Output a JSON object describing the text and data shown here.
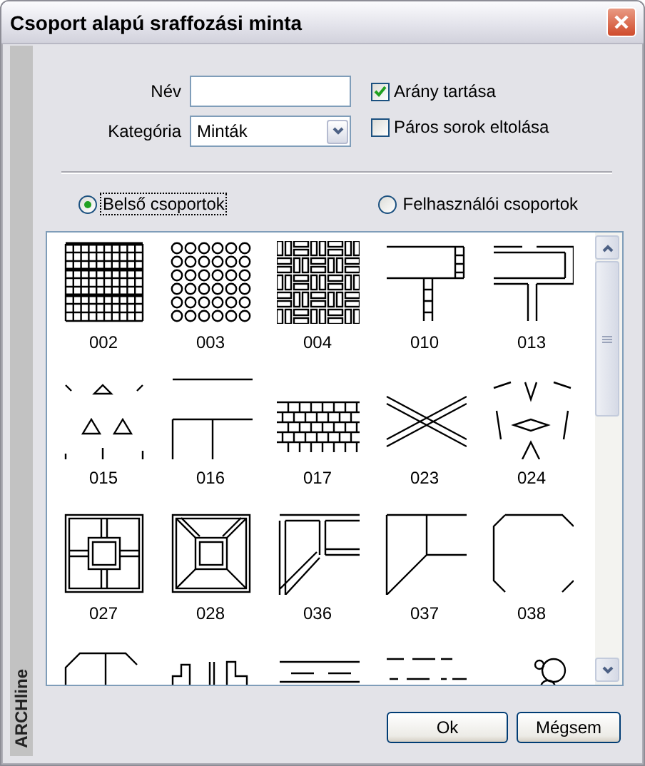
{
  "window": {
    "title": "Csoport alapú sraffozási minta"
  },
  "side_label": "ARCHline",
  "form": {
    "name": {
      "label": "Név"
    },
    "category": {
      "label": "Kategória",
      "value": "Minták"
    }
  },
  "options": [
    {
      "label": "Arány tartása",
      "checked": true
    },
    {
      "label": "Páros sorok eltolása",
      "checked": false
    }
  ],
  "groups": [
    {
      "label": "Belső csoportok",
      "selected": true
    },
    {
      "label": "Felhasználói csoportok",
      "selected": false
    }
  ],
  "patterns": [
    {
      "kind": "pattern",
      "label": "002"
    },
    {
      "kind": "pattern",
      "label": "003"
    },
    {
      "kind": "pattern",
      "label": "004"
    },
    {
      "kind": "pattern",
      "label": "010"
    },
    {
      "kind": "pattern",
      "label": "013"
    },
    {
      "kind": "pattern",
      "label": "015"
    },
    {
      "kind": "pattern",
      "label": "016"
    },
    {
      "kind": "pattern",
      "label": "017"
    },
    {
      "kind": "pattern",
      "label": "023"
    },
    {
      "kind": "pattern",
      "label": "024"
    },
    {
      "kind": "pattern",
      "label": "027"
    },
    {
      "kind": "pattern",
      "label": "028"
    },
    {
      "kind": "pattern",
      "label": "036"
    },
    {
      "kind": "pattern",
      "label": "037"
    },
    {
      "kind": "pattern",
      "label": "038"
    },
    {
      "kind": "pattern"
    },
    {
      "kind": "pattern"
    },
    {
      "kind": "pattern"
    },
    {
      "kind": "pattern"
    },
    {
      "kind": "pattern"
    }
  ],
  "buttons": [
    {
      "label": "Ok"
    },
    {
      "label": "Mégsem"
    }
  ]
}
